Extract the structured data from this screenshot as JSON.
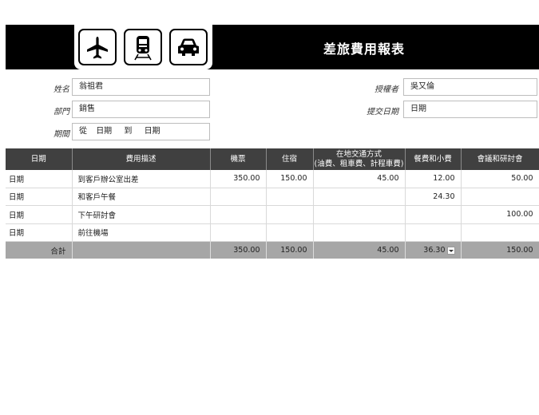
{
  "header": {
    "title": "差旅費用報表",
    "icons": [
      "airplane-icon",
      "train-icon",
      "car-icon"
    ]
  },
  "form": {
    "name_label": "姓名",
    "name_value": "翁祖君",
    "department_label": "部門",
    "department_value": "銷售",
    "period_label": "期間",
    "period_from": "從",
    "period_start": "日期",
    "period_to": "到",
    "period_end": "日期",
    "approver_label": "授權者",
    "approver_value": "吳又倫",
    "submit_date_label": "提交日期",
    "submit_date_value": "日期"
  },
  "table": {
    "columns": {
      "date": "日期",
      "description": "費用描述",
      "airfare": "機票",
      "lodging": "住宿",
      "transport_line1": "在地交通方式",
      "transport_line2": "(油費、租車費、計程車費)",
      "meals": "餐費和小費",
      "conference": "會議和研討會"
    },
    "rows": [
      {
        "date": "日期",
        "description": "到客戶辦公室出差",
        "airfare": "350.00",
        "lodging": "150.00",
        "transport": "45.00",
        "meals": "12.00",
        "conference": "50.00"
      },
      {
        "date": "日期",
        "description": "和客戶午餐",
        "airfare": "",
        "lodging": "",
        "transport": "",
        "meals": "24.30",
        "conference": ""
      },
      {
        "date": "日期",
        "description": "下午研討會",
        "airfare": "",
        "lodging": "",
        "transport": "",
        "meals": "",
        "conference": "100.00"
      },
      {
        "date": "日期",
        "description": "前往機場",
        "airfare": "",
        "lodging": "",
        "transport": "",
        "meals": "",
        "conference": ""
      }
    ],
    "total": {
      "label": "合計",
      "airfare": "350.00",
      "lodging": "150.00",
      "transport": "45.00",
      "meals": "36.30",
      "conference": "150.00"
    }
  }
}
